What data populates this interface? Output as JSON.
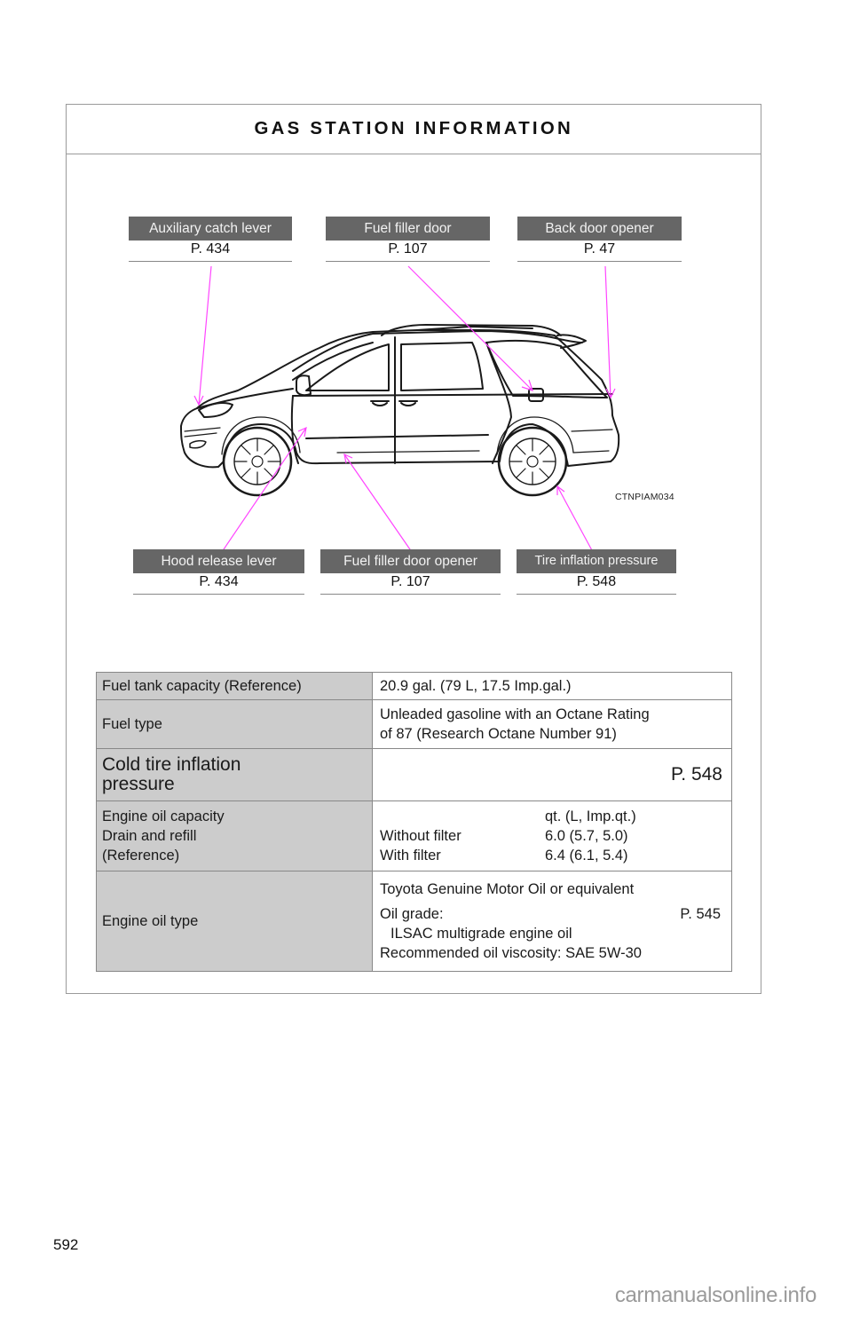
{
  "header": {
    "title": "GAS STATION INFORMATION"
  },
  "callouts": {
    "top": [
      {
        "label": "Auxiliary catch lever",
        "page": "P. 434"
      },
      {
        "label": "Fuel filler door",
        "page": "P. 107"
      },
      {
        "label": "Back door opener",
        "page": "P. 47"
      }
    ],
    "bottom": [
      {
        "label": "Hood release lever",
        "page": "P. 434"
      },
      {
        "label": "Fuel filler door opener",
        "page": "P. 107"
      },
      {
        "label": "Tire inflation pressure",
        "page": "P. 548"
      }
    ]
  },
  "figure": {
    "code": "CTNPIAM034",
    "leader_color": "#ff44ff",
    "subject": "minivan-side-view"
  },
  "spec_table": {
    "fuel_tank": {
      "label": "Fuel tank capacity (Reference)",
      "value": "20.9 gal. (79 L, 17.5 Imp.gal.)"
    },
    "fuel_type": {
      "label": "Fuel type",
      "value_line1": "Unleaded gasoline with an Octane Rating",
      "value_line2": "of 87 (Research Octane Number 91)"
    },
    "cold_tire": {
      "label_line1": "Cold tire inflation",
      "label_line2": "pressure",
      "value": "P. 548"
    },
    "oil_capacity": {
      "label_line1": "Engine oil capacity",
      "label_line2": "Drain and refill",
      "label_line3": "(Reference)",
      "unit_header": "qt. (L, Imp.qt.)",
      "rows": [
        {
          "name": "Without filter",
          "value": "6.0 (5.7, 5.0)"
        },
        {
          "name": "With filter",
          "value": "6.4 (6.1, 5.4)"
        }
      ]
    },
    "oil_type": {
      "label": "Engine oil type",
      "line1": "Toyota Genuine Motor Oil or equivalent",
      "grade_label": "Oil grade:",
      "grade_page": "P. 545",
      "grade_value": "ILSAC multigrade engine oil",
      "viscosity": "Recommended oil viscosity: SAE 5W-30"
    }
  },
  "footer": {
    "page_number": "592",
    "watermark": "carmanualsonline.info"
  },
  "colors": {
    "label_bg": "#666666",
    "key_cell_bg": "#cccccc",
    "leader": "#ff44ff"
  }
}
